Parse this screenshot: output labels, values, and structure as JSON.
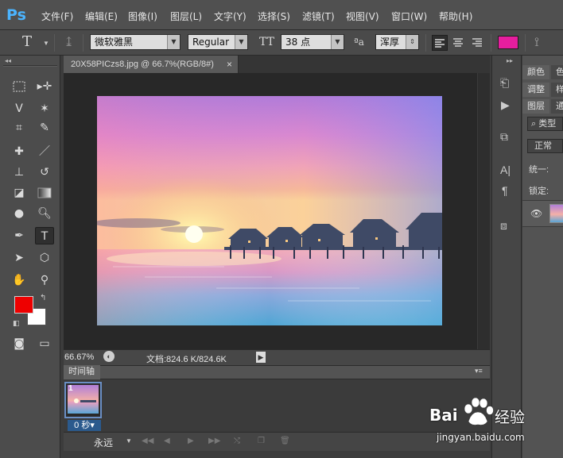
{
  "app": {
    "logo": "Ps"
  },
  "menu": [
    "文件(F)",
    "编辑(E)",
    "图像(I)",
    "图层(L)",
    "文字(Y)",
    "选择(S)",
    "滤镜(T)",
    "视图(V)",
    "窗口(W)",
    "帮助(H)"
  ],
  "options": {
    "tool_glyph": "T",
    "font_family": "微软雅黑",
    "font_style": "Regular",
    "font_size": "38 点",
    "aa_glyph": "ªa",
    "antialias": "浑厚",
    "text_color": "#e61e9e"
  },
  "document": {
    "tab_title": "20X58PICzs8.jpg @ 66.7%(RGB/8#)",
    "close_glyph": "×",
    "zoom": "66.67%",
    "doc_size": "文档:824.6 K/824.6K"
  },
  "colors": {
    "foreground": "#ee0000",
    "background": "#ffffff",
    "accent": "#2b5a8d"
  },
  "timeline": {
    "title": "时间轴",
    "frame_number": "1",
    "frame_delay": "0 秒▾",
    "loop": "永远"
  },
  "right_panel": {
    "tab_color": "颜色",
    "tab_color_more": "色",
    "tab_adjust": "调整",
    "tab_adjust_more": "样",
    "tab_layers": "图层",
    "tab_layers_more": "通",
    "filter_label": "类型",
    "blend_mode": "正常",
    "unify_label": "统一:",
    "lock_label": "锁定:"
  },
  "watermark": {
    "brand": "Bai",
    "text": "经验",
    "url": "jingyan.baidu.com"
  },
  "icons": {
    "tools": [
      "marquee-icon",
      "move-icon",
      "lasso-icon",
      "magic-wand-icon",
      "crop-icon",
      "eyedropper-icon",
      "healing-brush-icon",
      "brush-icon",
      "clone-stamp-icon",
      "history-brush-icon",
      "eraser-icon",
      "gradient-icon",
      "blur-icon",
      "dodge-icon",
      "pen-icon",
      "type-icon",
      "path-selection-icon",
      "shape-icon",
      "hand-icon",
      "zoom-icon"
    ]
  }
}
